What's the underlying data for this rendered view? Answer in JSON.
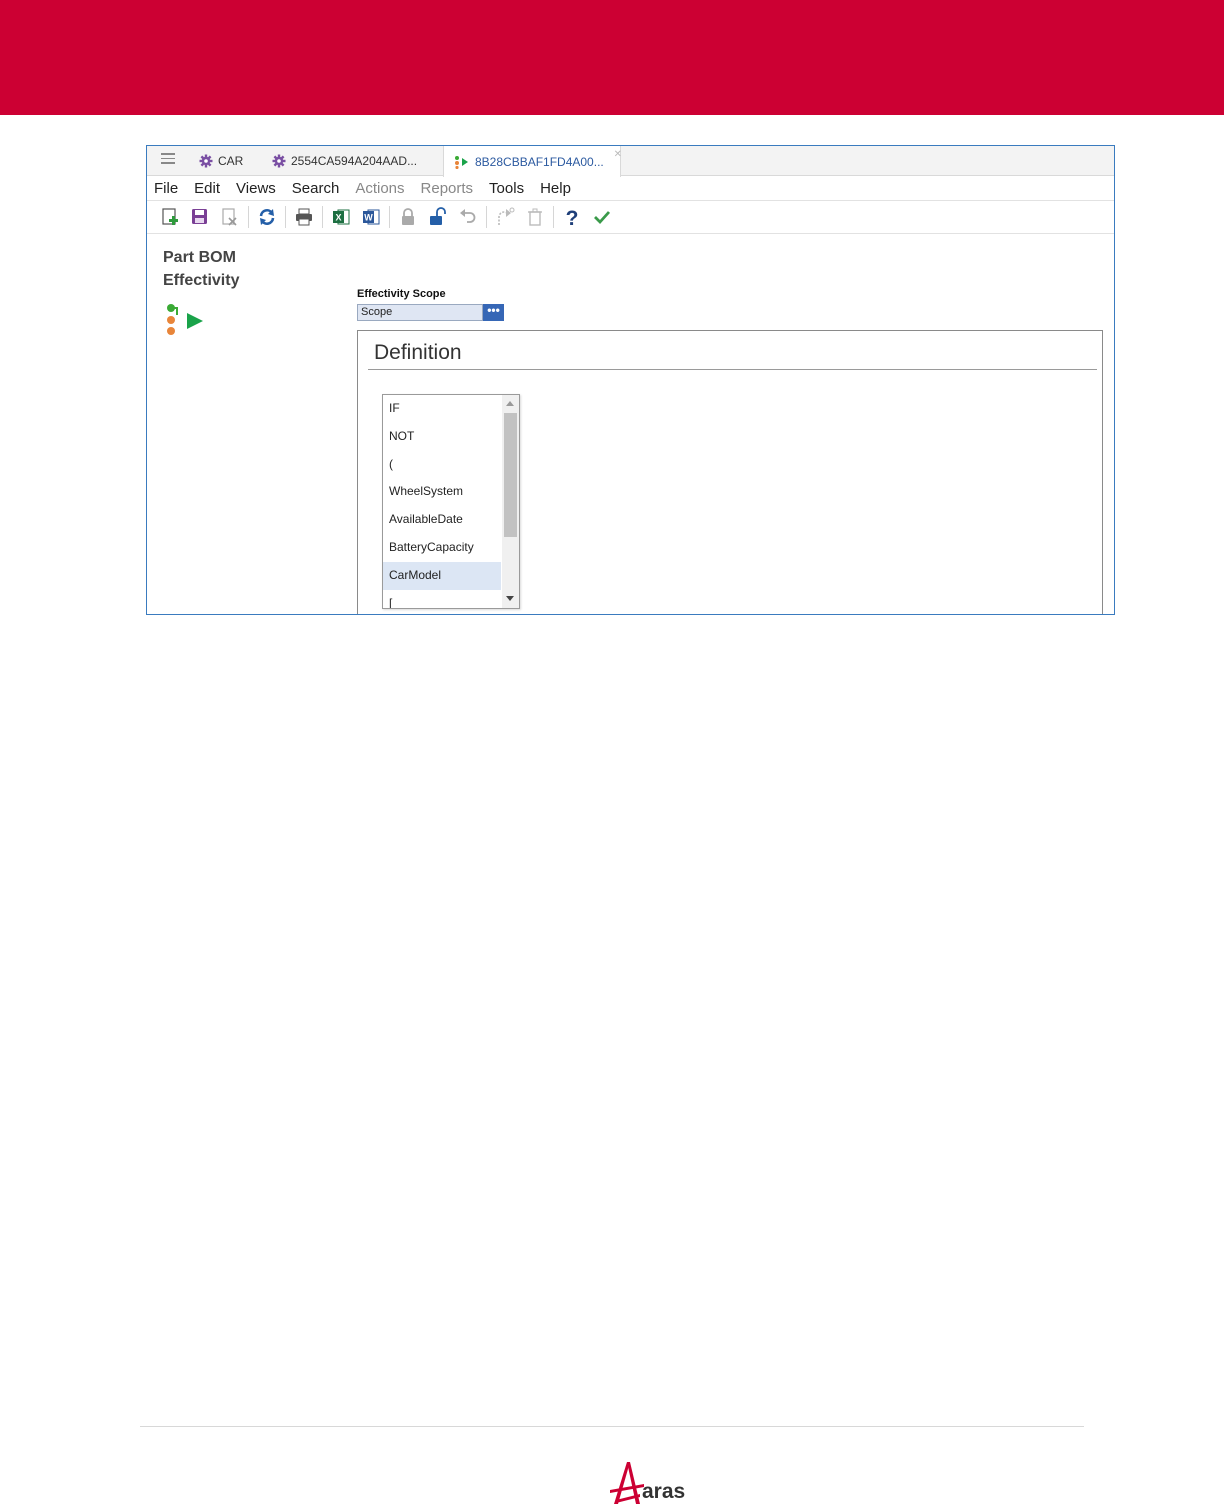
{
  "tabs": [
    {
      "label": "CAR",
      "icon": "gear-icon"
    },
    {
      "label": "2554CA594A204AAD...",
      "icon": "gear-icon"
    },
    {
      "label": "8B28CBBAF1FD4A00...",
      "icon": "effectivity-icon",
      "active": true
    }
  ],
  "menu": [
    "File",
    "Edit",
    "Views",
    "Search",
    "Actions",
    "Reports",
    "Tools",
    "Help"
  ],
  "menu_disabled": [
    "Actions",
    "Reports"
  ],
  "toolbar_icons": [
    "new-icon",
    "save-icon",
    "discard-icon",
    "refresh-icon",
    "print-icon",
    "excel-icon",
    "word-icon",
    "lock-icon",
    "unlock-icon",
    "undo-icon",
    "promote-icon",
    "delete-icon",
    "help-icon",
    "done-icon"
  ],
  "form": {
    "title_line1": "Part BOM",
    "title_line2": "Effectivity",
    "scope_label": "Effectivity Scope",
    "scope_value": "Scope",
    "scope_button": "•••",
    "definition_title": "Definition"
  },
  "list": {
    "items": [
      "IF",
      "NOT",
      "(",
      "WheelSystem",
      "AvailableDate",
      "BatteryCapacity",
      "CarModel",
      "["
    ],
    "selected": "CarModel"
  },
  "footer": {
    "logo_text": "aras"
  },
  "colors": {
    "banner": "#cc0033",
    "accent": "#3667b6",
    "window_border": "#3a7bbf",
    "selected_row": "#dce6f4"
  }
}
